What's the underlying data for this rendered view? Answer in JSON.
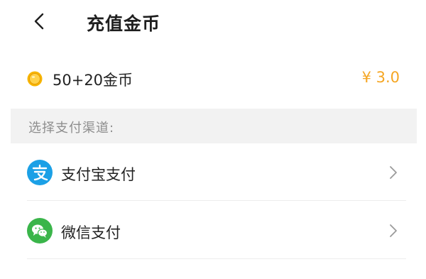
{
  "header": {
    "title": "充值金币"
  },
  "product": {
    "name": "50+20金币",
    "price": "¥ 3.0",
    "icon": "coin-icon"
  },
  "payment": {
    "section_label": "选择支付渠道:",
    "options": [
      {
        "label": "支付宝支付",
        "icon": "alipay-icon",
        "color": "#1ba0e6"
      },
      {
        "label": "微信支付",
        "icon": "wechat-icon",
        "color": "#3ab54a"
      }
    ]
  },
  "colors": {
    "price": "#f5a623",
    "section_bg": "#f2f2f2"
  }
}
